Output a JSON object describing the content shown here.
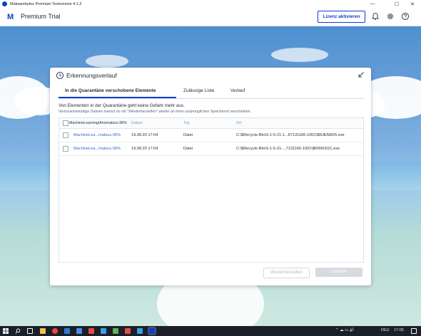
{
  "window": {
    "title": "Malwarebytes Premium Testversion  4.1.2",
    "controls": [
      "—",
      "☐",
      "✕"
    ]
  },
  "header": {
    "product": "Premium Trial",
    "license_button": "Lizenz aktivieren",
    "icons": [
      "bell-icon",
      "gear-icon",
      "help-icon"
    ]
  },
  "dialog": {
    "title": "Erkennungsverlauf",
    "tabs": [
      {
        "label": "In die Quarantäne verschobene Elemente",
        "active": true
      },
      {
        "label": "Zulässige Liste",
        "active": false
      },
      {
        "label": "Verlauf",
        "active": false
      }
    ],
    "info_line1": "Von Elementen in der Quarantäne geht keine Gefahr mehr aus.",
    "info_line2": "Vertrauenswürdige Dateien kannst du mit \"Wiederherstellen\" wieder an ihren ursprünglichen Speicherort verschieben.",
    "table": {
      "columns": [
        "MachineLearning/Anomalous.96%",
        "Datum",
        "Typ",
        "Ort"
      ],
      "rows": [
        {
          "name": "MachineLea...malous.96%",
          "date": "19.08.20 17:04",
          "type": "Datei",
          "location": "C:\\$Recycle.Bin\\S-1-5-21-1...67131166-1001\\$RJEN6D5.exe"
        },
        {
          "name": "MachineLea...malous.96%",
          "date": "19.08.20 17:04",
          "type": "Datei",
          "location": "C:\\$Recycle.Bin\\S-1-5-21-...7131166-1001\\$R9903UC.exe"
        }
      ]
    },
    "buttons": {
      "restore": "Wiederherstellen",
      "delete": "Löschen"
    }
  },
  "taskbar": {
    "language": "DEU",
    "time": "17:05"
  },
  "colors": {
    "accent": "#0d3ecc",
    "link": "#2f64d8",
    "taskbar": "#1b1f2a"
  }
}
